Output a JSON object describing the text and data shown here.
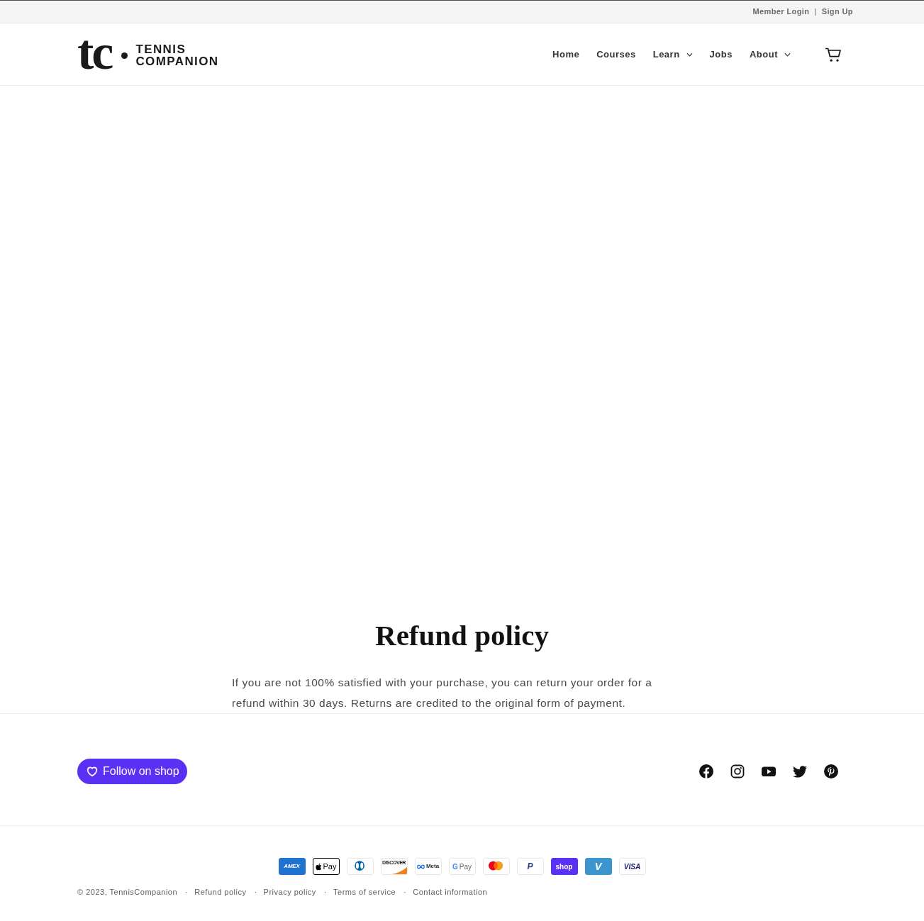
{
  "top_bar": {
    "links": [
      {
        "label": "Member Login"
      },
      {
        "label": "Sign Up"
      }
    ],
    "separator": "|"
  },
  "header": {
    "logo": {
      "monogram": "tc",
      "name": "TENNIS COMPANION"
    },
    "nav": [
      {
        "label": "Home",
        "has_menu": false
      },
      {
        "label": "Courses",
        "has_menu": false
      },
      {
        "label": "Learn",
        "has_menu": true
      },
      {
        "label": "Jobs",
        "has_menu": false
      },
      {
        "label": "About",
        "has_menu": true
      }
    ]
  },
  "page": {
    "title": "Refund policy",
    "body": "If you are not 100% satisfied with your purchase, you can return your order for a refund within 30 days. Returns are credited to the original form of payment."
  },
  "footer": {
    "follow_button": {
      "label": "Follow on shop"
    },
    "social_links": [
      {
        "kind": "facebook"
      },
      {
        "kind": "instagram"
      },
      {
        "kind": "youtube"
      },
      {
        "kind": "twitter"
      },
      {
        "kind": "pinterest"
      }
    ],
    "payment_methods": [
      {
        "kind": "amex",
        "label": "AMEX"
      },
      {
        "kind": "apple_pay",
        "label": "Pay"
      },
      {
        "kind": "diners"
      },
      {
        "kind": "discover",
        "label": "DISCOVER"
      },
      {
        "kind": "meta_pay",
        "label": "Meta"
      },
      {
        "kind": "google_pay",
        "mark": "G",
        "label": "Pay"
      },
      {
        "kind": "mastercard"
      },
      {
        "kind": "paypal",
        "label": "P"
      },
      {
        "kind": "shop_pay",
        "label": "shop"
      },
      {
        "kind": "venmo",
        "label": "V"
      },
      {
        "kind": "visa",
        "label": "VISA"
      }
    ],
    "copyright": "© 2023, TennisCompanion",
    "policy_links": [
      {
        "label": "Refund policy"
      },
      {
        "label": "Privacy policy"
      },
      {
        "label": "Terms of service"
      },
      {
        "label": "Contact information"
      }
    ],
    "separator": "·"
  }
}
